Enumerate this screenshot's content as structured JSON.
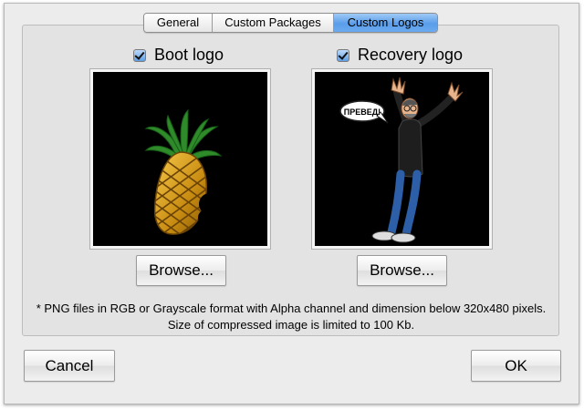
{
  "tabs": [
    {
      "label": "General",
      "selected": false
    },
    {
      "label": "Custom Packages",
      "selected": false
    },
    {
      "label": "Custom Logos",
      "selected": true
    }
  ],
  "boot_logo": {
    "label": "Boot logo",
    "checked": true,
    "browse_label": "Browse..."
  },
  "recovery_logo": {
    "label": "Recovery logo",
    "checked": true,
    "browse_label": "Browse...",
    "speech_text": "ПРЕВЕД!"
  },
  "note": "* PNG files in RGB or Grayscale format with Alpha channel and dimension below 320x480 pixels. Size of compressed image is limited to 100 Kb.",
  "footer": {
    "cancel_label": "Cancel",
    "ok_label": "OK"
  },
  "colors": {
    "tab_selected": "#5a9de9",
    "panel_bg": "#e3e3e3",
    "window_bg": "#ececec",
    "well_bg": "#000000"
  }
}
